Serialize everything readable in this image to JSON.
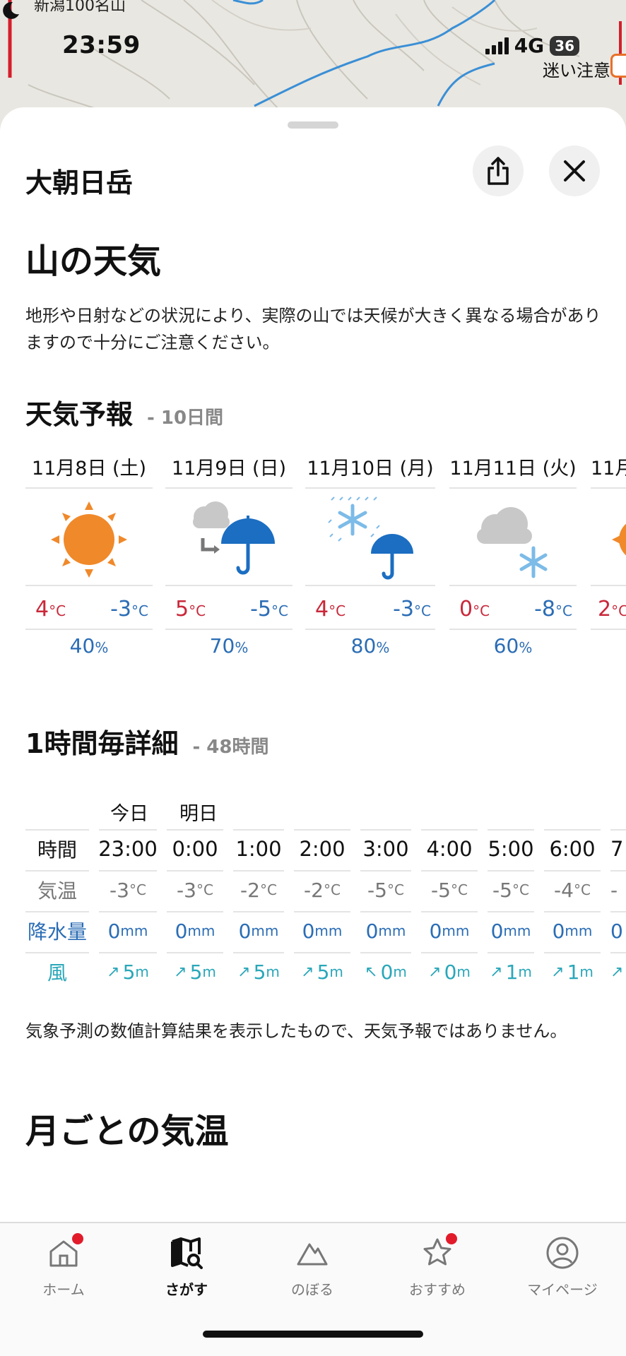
{
  "map": {
    "top_label": "新潟100名山",
    "warning": "迷い注意"
  },
  "status_bar": {
    "time": "23:59",
    "network": "4G",
    "battery": "36"
  },
  "sheet": {
    "mountain_name": "大朝日岳",
    "share_icon": "share-icon",
    "close_icon": "close-icon"
  },
  "weather": {
    "title": "山の天気",
    "note": "地形や日射などの状況により、実際の山では天候が大きく異なる場合がありますので十分にご注意ください。"
  },
  "forecast": {
    "title": "天気予報",
    "suffix": "- 10日間",
    "temp_unit": "°C",
    "pop_unit": "%",
    "days": [
      {
        "date": "11月8日 (土)",
        "icon": "sunny-icon",
        "high": "4",
        "low": "-3",
        "pop": "40"
      },
      {
        "date": "11月9日 (日)",
        "icon": "cloudy-then-rain-icon",
        "high": "5",
        "low": "-5",
        "pop": "70"
      },
      {
        "date": "11月10日 (月)",
        "icon": "snow-and-rain-icon",
        "high": "4",
        "low": "-3",
        "pop": "80"
      },
      {
        "date": "11月11日 (火)",
        "icon": "cloudy-snow-icon",
        "high": "0",
        "low": "-8",
        "pop": "60"
      },
      {
        "date": "11月",
        "icon": "sunny-icon",
        "high": "2",
        "low": "",
        "pop": ""
      }
    ]
  },
  "hourly": {
    "title": "1時間毎詳細",
    "suffix": "- 48時間",
    "day_labels": {
      "today": "今日",
      "tomorrow": "明日"
    },
    "row_labels": {
      "time": "時間",
      "temp": "気温",
      "rain": "降水量",
      "wind": "風"
    },
    "temp_unit": "°C",
    "rain_unit": "mm",
    "wind_unit": "m",
    "hours": [
      {
        "time": "23:00",
        "temp": "-3",
        "rain": "0",
        "wind_dir": "↗",
        "wind": "5"
      },
      {
        "time": "0:00",
        "temp": "-3",
        "rain": "0",
        "wind_dir": "↗",
        "wind": "5"
      },
      {
        "time": "1:00",
        "temp": "-2",
        "rain": "0",
        "wind_dir": "↗",
        "wind": "5"
      },
      {
        "time": "2:00",
        "temp": "-2",
        "rain": "0",
        "wind_dir": "↗",
        "wind": "5"
      },
      {
        "time": "3:00",
        "temp": "-5",
        "rain": "0",
        "wind_dir": "↖",
        "wind": "0"
      },
      {
        "time": "4:00",
        "temp": "-5",
        "rain": "0",
        "wind_dir": "↗",
        "wind": "0"
      },
      {
        "time": "5:00",
        "temp": "-5",
        "rain": "0",
        "wind_dir": "↗",
        "wind": "1"
      },
      {
        "time": "6:00",
        "temp": "-4",
        "rain": "0",
        "wind_dir": "↗",
        "wind": "1"
      },
      {
        "time": "7",
        "temp": "-",
        "rain": "0",
        "wind_dir": "↗",
        "wind": ""
      }
    ],
    "note": "気象予測の数値計算結果を表示したもので、天気予報ではありません。"
  },
  "monthly": {
    "title": "月ごとの気温"
  },
  "nav": {
    "items": [
      {
        "label": "ホーム",
        "icon": "home-icon",
        "badge": true
      },
      {
        "label": "さがす",
        "icon": "map-search-icon",
        "badge": false,
        "active": true
      },
      {
        "label": "のぼる",
        "icon": "mountain-icon",
        "badge": false
      },
      {
        "label": "おすすめ",
        "icon": "star-icon",
        "badge": true
      },
      {
        "label": "マイページ",
        "icon": "user-icon",
        "badge": false
      }
    ]
  },
  "colors": {
    "high_temp": "#c9283a",
    "low_temp": "#2b6db5",
    "wind": "#2aa7b9",
    "badge": "#e21b2b",
    "sun": "#f0892a"
  }
}
